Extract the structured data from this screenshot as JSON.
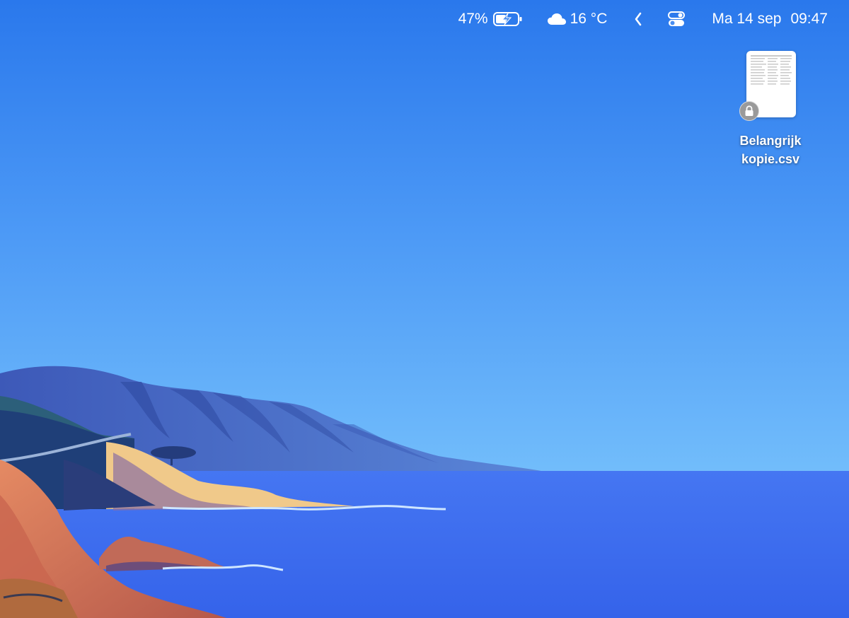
{
  "menubar": {
    "battery_percent": "47%",
    "battery_level": 0.47,
    "battery_charging": true,
    "weather_icon": "cloud-icon",
    "temperature": "16 °C",
    "chevron_icon": "chevron-left-icon",
    "control_center_icon": "control-center-icon",
    "date": "Ma 14 sep",
    "time": "09:47"
  },
  "desktop": {
    "files": [
      {
        "label_line1": "Belangrijk",
        "label_line2": "kopie.csv",
        "icon": "csv-document-icon",
        "badge": "lock-icon"
      }
    ]
  },
  "colors": {
    "sky_top": "#2d7ded",
    "sky_bottom": "#6fbcfb",
    "sea": "#3e6ef0",
    "menubar_text": "#ffffff"
  }
}
